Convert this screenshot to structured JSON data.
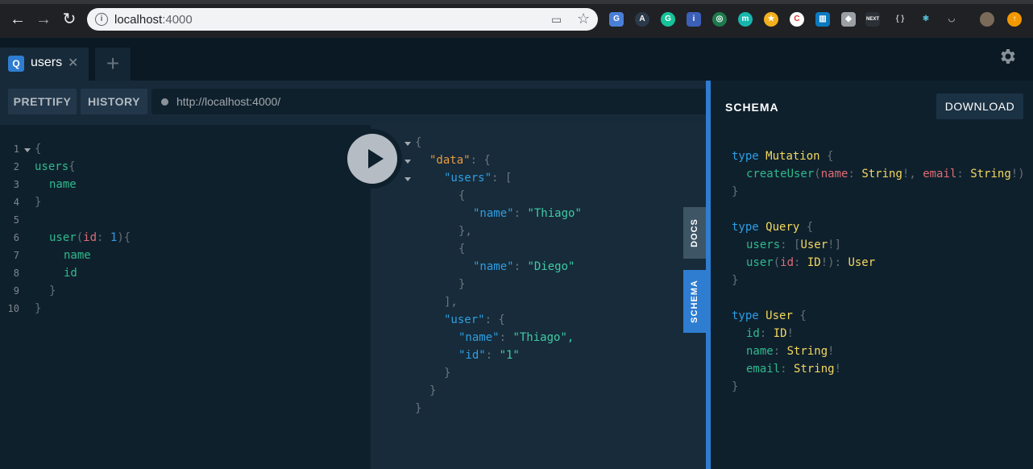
{
  "browser": {
    "url_host": "localhost",
    "url_port": ":4000",
    "ext_icons": [
      "translate-icon",
      "shield-icon",
      "grammarly-icon",
      "reader-icon",
      "target-icon",
      "m-icon",
      "star-icon",
      "c-icon",
      "trello-icon",
      "owl-icon",
      "next-icon",
      "bracket-icon",
      "react-icon",
      "pocket-icon",
      "profile-avatar",
      "update-icon"
    ]
  },
  "tabs": [
    {
      "label": "users"
    }
  ],
  "toolbar": {
    "prettify_label": "PRETTIFY",
    "history_label": "HISTORY",
    "endpoint_url": "http://localhost:4000/"
  },
  "query_editor": {
    "line_numbers": [
      "1",
      "2",
      "3",
      "4",
      "5",
      "6",
      "7",
      "8",
      "9",
      "10"
    ],
    "lines": {
      "l1_open": "{",
      "l2_field": "users",
      "l2_brace": "{",
      "l3_field": "name",
      "l4_close": "}",
      "l6_field": "user",
      "l6_paren_open": "(",
      "l6_arg": "id",
      "l6_colon": ":",
      "l6_num": "1",
      "l6_paren_close": "){",
      "l7_field": "name",
      "l8_field": "id",
      "l9_close": "}",
      "l10_close": "}"
    }
  },
  "result": {
    "brace_open": "{",
    "data_key": "\"data\"",
    "users_key": "\"users\"",
    "name_key": "\"name\"",
    "user_key": "\"user\"",
    "id_key": "\"id\"",
    "thiago": "\"Thiago\"",
    "diego": "\"Diego\"",
    "thiago_comma": "\"Thiago\",",
    "id_value": "\"1\"",
    "colon_brace": ": {",
    "colon_bracket": ": [",
    "colon": ": ",
    "obj_open": "{",
    "obj_close": "}",
    "obj_close_comma": "},",
    "arr_close_comma": "],"
  },
  "side_tabs": {
    "docs": "DOCS",
    "schema": "SCHEMA"
  },
  "schema": {
    "title": "SCHEMA",
    "download_label": "DOWNLOAD",
    "kw_type": "type",
    "mutation": "Mutation",
    "query": "Query",
    "user_type": "User",
    "create_user": "createUser",
    "arg_name": "name",
    "arg_email": "email",
    "arg_id": "id",
    "string": "String",
    "id_type": "ID",
    "users_field": "users",
    "user_field": "user",
    "id_field": "id",
    "name_field": "name",
    "email_field": "email"
  },
  "colors": {
    "accent": "#2e7dd1",
    "background": "#0f202d",
    "field": "#2fba8d",
    "type": "#f5d85e",
    "string": "#3ecba4",
    "arg": "#e06c75"
  }
}
